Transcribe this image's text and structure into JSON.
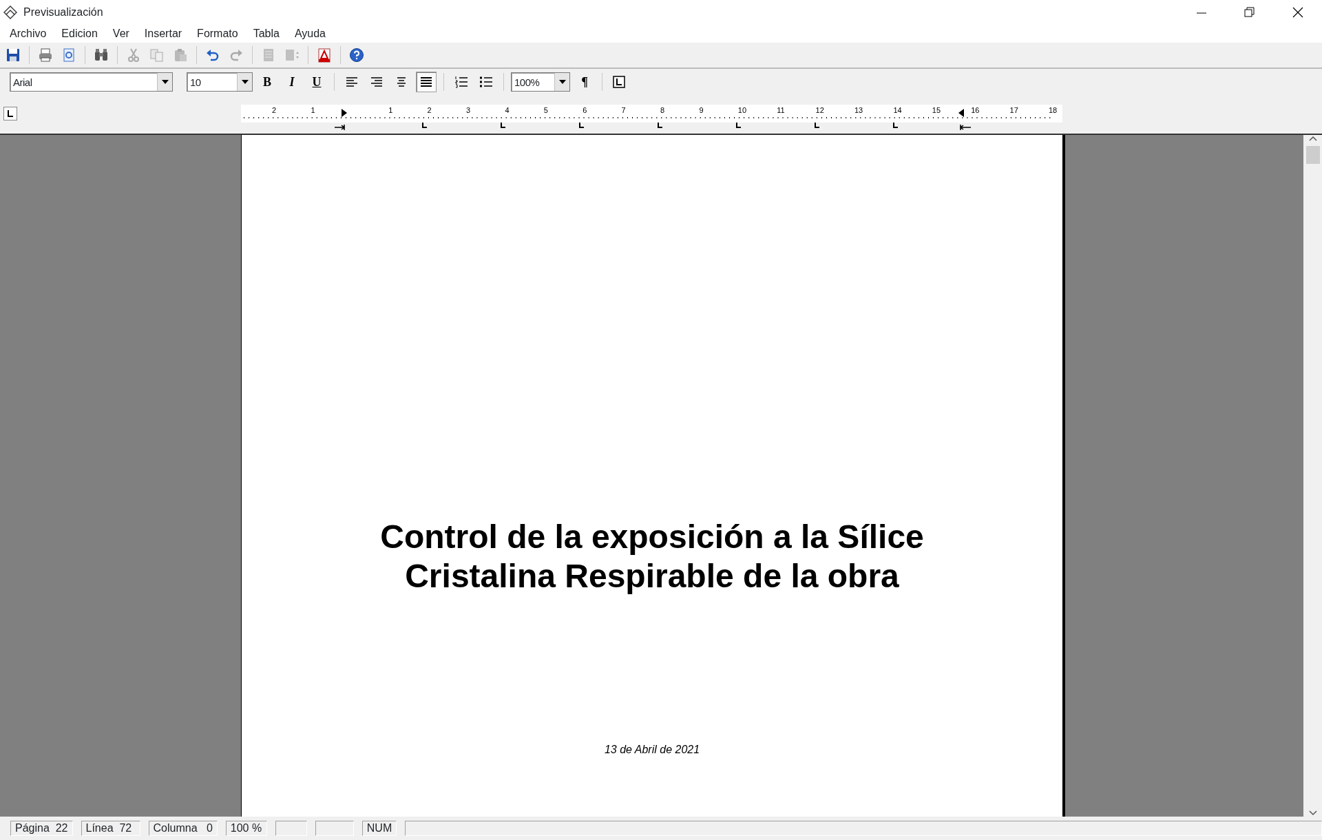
{
  "window": {
    "title": "Previsualización"
  },
  "menu": [
    "Archivo",
    "Edicion",
    "Ver",
    "Insertar",
    "Formato",
    "Tabla",
    "Ayuda"
  ],
  "toolbar": [
    {
      "kind": "save",
      "disabled": false
    },
    {
      "kind": "separator"
    },
    {
      "kind": "print",
      "disabled": false
    },
    {
      "kind": "preview",
      "disabled": false
    },
    {
      "kind": "separator"
    },
    {
      "kind": "find",
      "disabled": false
    },
    {
      "kind": "separator"
    },
    {
      "kind": "cut",
      "disabled": true
    },
    {
      "kind": "copy",
      "disabled": true
    },
    {
      "kind": "paste",
      "disabled": true
    },
    {
      "kind": "separator"
    },
    {
      "kind": "undo",
      "disabled": false
    },
    {
      "kind": "redo",
      "disabled": true
    },
    {
      "kind": "separator"
    },
    {
      "kind": "page",
      "disabled": true
    },
    {
      "kind": "pagebreak",
      "disabled": true
    },
    {
      "kind": "separator"
    },
    {
      "kind": "pdf",
      "disabled": false
    },
    {
      "kind": "separator"
    },
    {
      "kind": "help",
      "disabled": false
    }
  ],
  "format_bar": {
    "font": "Arial",
    "size": "10",
    "zoom": "100%",
    "buttons": [
      {
        "kind": "bold",
        "label": "B",
        "selected": false
      },
      {
        "kind": "italic",
        "label": "I",
        "selected": false
      },
      {
        "kind": "underline",
        "label": "U",
        "selected": false
      },
      {
        "kind": "separator"
      },
      {
        "kind": "align-left",
        "selected": false
      },
      {
        "kind": "align-right",
        "selected": false
      },
      {
        "kind": "align-center",
        "selected": false
      },
      {
        "kind": "justify",
        "selected": true
      },
      {
        "kind": "separator"
      },
      {
        "kind": "numbered",
        "selected": false
      },
      {
        "kind": "bullets",
        "selected": false
      },
      {
        "kind": "separator"
      },
      {
        "kind": "zoom"
      },
      {
        "kind": "pilcrow",
        "label": "¶",
        "selected": false
      },
      {
        "kind": "separator"
      },
      {
        "kind": "tabstop",
        "selected": false
      }
    ]
  },
  "ruler": {
    "labels": [
      "2",
      "1",
      "1",
      "2",
      "3",
      "4",
      "5",
      "6",
      "7",
      "8",
      "9",
      "10",
      "11",
      "12",
      "13",
      "14",
      "15",
      "16",
      "17",
      "18"
    ]
  },
  "document": {
    "title_lines": [
      "Control de la exposición a la Sílice",
      "Cristalina Respirable de la obra"
    ],
    "date": "13 de Abril de 2021"
  },
  "status_bar": [
    "Página  22",
    "Línea  72",
    "Columna   0",
    "100 %",
    "NUM"
  ]
}
